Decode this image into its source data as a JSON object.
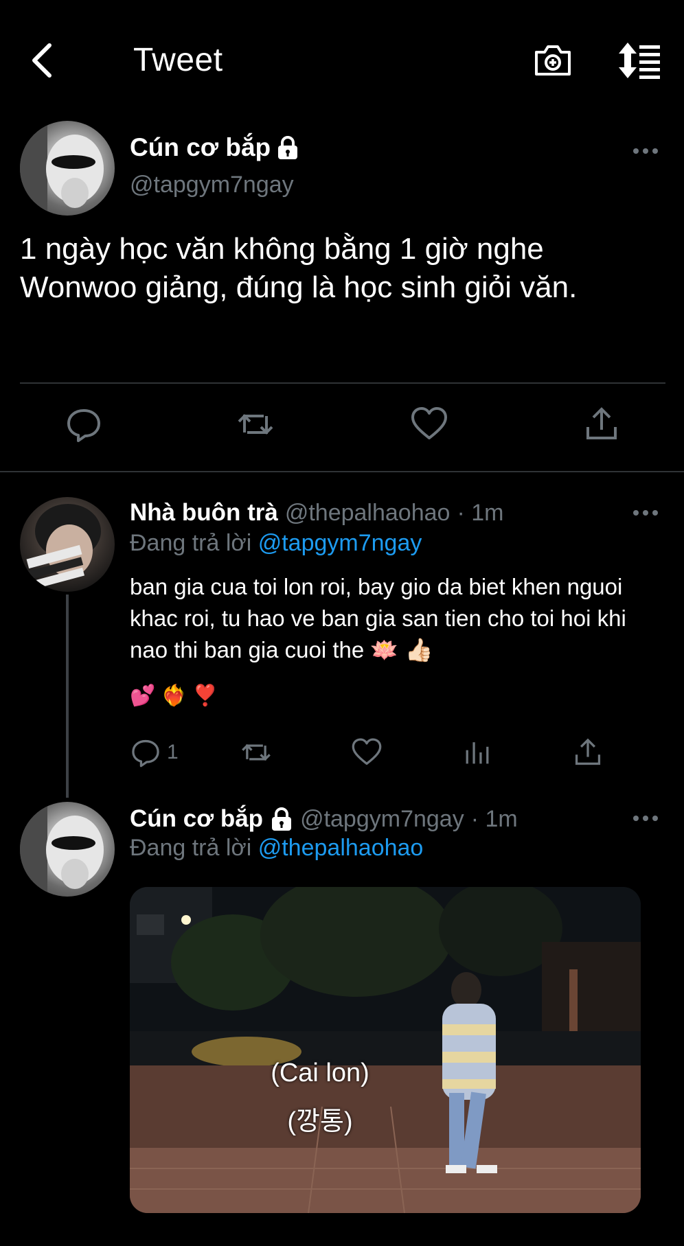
{
  "header": {
    "title": "Tweet"
  },
  "main_tweet": {
    "display_name": "Cún cơ bắp",
    "handle": "@tapgym7ngay",
    "text": "1 ngày học văn không bằng 1 giờ nghe Wonwoo giảng, đúng là học sinh giỏi văn."
  },
  "replies": [
    {
      "display_name": "Nhà buôn trà",
      "handle": "@thepalhaohao",
      "time": "· 1m",
      "replying_label": "Đang trả lời",
      "replying_to": "@tapgym7ngay",
      "text": "ban gia cua toi lon roi, bay gio da biet khen nguoi khac roi, tu hao ve ban gia san tien cho toi hoi khi nao thi ban gia cuoi the 🪷 👍🏻",
      "emojis": "💕 ❤️‍🔥 ❣️",
      "reply_count": "1"
    },
    {
      "display_name": "Cún cơ bắp",
      "handle": "@tapgym7ngay",
      "time": "· 1m",
      "replying_label": "Đang trả lời",
      "replying_to": "@thepalhaohao",
      "media_subtitle_1": "(Cai lon)",
      "media_subtitle_2": "(깡통)"
    }
  ],
  "colors": {
    "background": "#000000",
    "secondary_text": "#6e767d",
    "accent": "#1d9bf0",
    "divider": "#2f3336"
  }
}
